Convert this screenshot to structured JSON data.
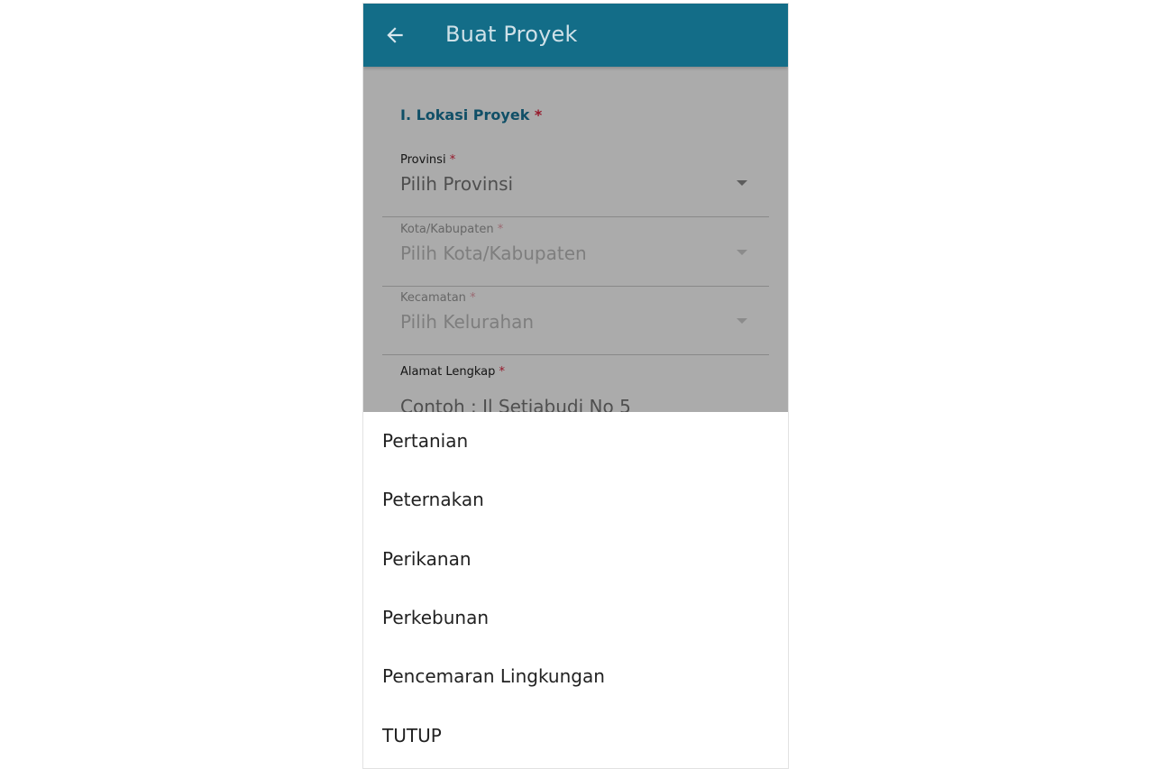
{
  "appbar": {
    "title": "Buat Proyek",
    "back_icon": "arrow-left-icon",
    "background": "#136d88"
  },
  "form": {
    "section_title": "I. Lokasi Proyek",
    "required_marker": "*",
    "fields": [
      {
        "label": "Provinsi",
        "value": "Pilih Provinsi",
        "enabled": true
      },
      {
        "label": "Kota/Kabupaten",
        "value": "Pilih Kota/Kabupaten",
        "enabled": false
      },
      {
        "label": "Kecamatan",
        "value": "Pilih Kelurahan",
        "enabled": false
      }
    ],
    "address": {
      "label": "Alamat Lengkap",
      "placeholder": "Contoh : Jl Setiabudi No 5"
    }
  },
  "sheet": {
    "options": [
      "Pertanian",
      "Peternakan",
      "Perikanan",
      "Perkebunan",
      "Pencemaran Lingkungan"
    ],
    "close_label": "TUTUP"
  }
}
